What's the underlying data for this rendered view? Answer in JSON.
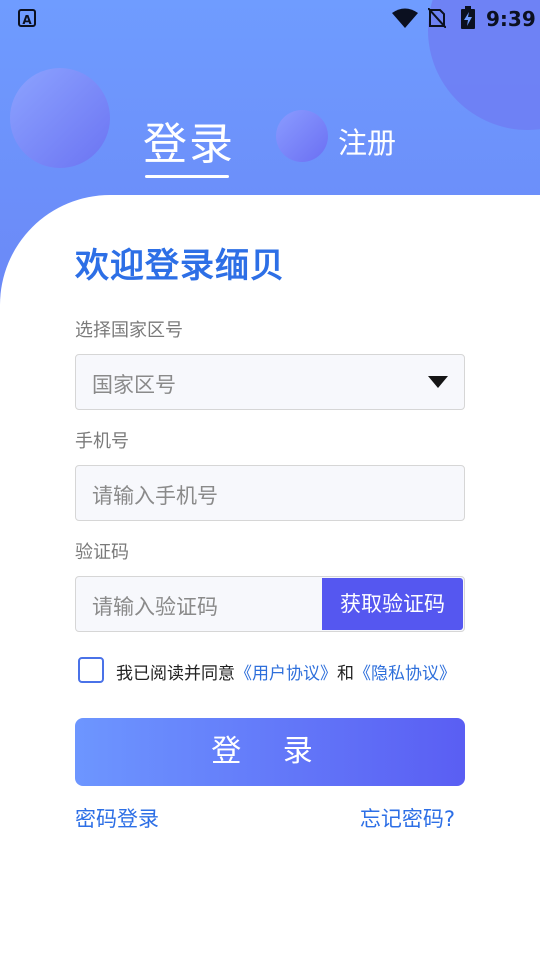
{
  "statusbar": {
    "app_icon_letter": "A",
    "time": "9:39"
  },
  "header": {
    "tab_login": "登录",
    "tab_register": "注册"
  },
  "main": {
    "welcome": "欢迎登录缅贝",
    "country": {
      "label": "选择国家区号",
      "placeholder": "国家区号"
    },
    "phone": {
      "label": "手机号",
      "placeholder": "请输入手机号"
    },
    "code": {
      "label": "验证码",
      "placeholder": "请输入验证码",
      "button": "获取验证码"
    },
    "agreement": {
      "prefix": "我已阅读并同意",
      "user_agreement": "《用户协议》",
      "and": "和",
      "privacy": "《隐私协议》",
      "checked": false
    },
    "submit": "登 录",
    "password_login": "密码登录",
    "forgot_password": "忘记密码?"
  },
  "colors": {
    "accent": "#2d6fe6",
    "button": "#5557f0",
    "header": "#6f9cff"
  }
}
